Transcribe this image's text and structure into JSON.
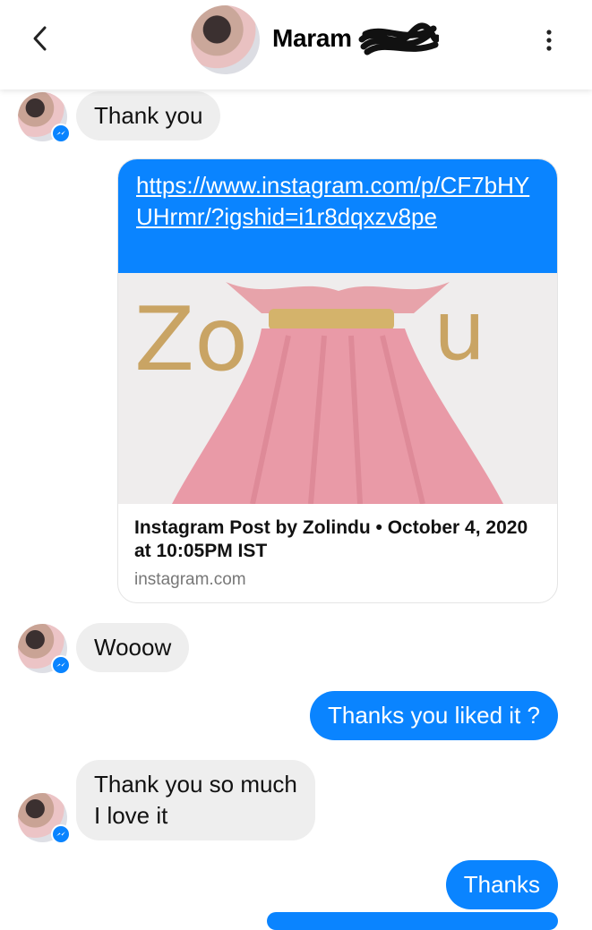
{
  "header": {
    "contact_name": "Maram"
  },
  "messages": {
    "m1": "Thank you",
    "link_url": "https://www.instagram.com/p/CF7bHYUHrmr/?igshid=i1r8dqxzv8pe",
    "link_preview_title": "Instagram Post by Zolindu • October  4, 2020 at 10:05PM IST",
    "link_preview_domain": "instagram.com",
    "m3": "Wooow",
    "m4": "Thanks you liked it ?",
    "m5_line1": "Thank you so much",
    "m5_line2": "I love it",
    "m6": "Thanks"
  },
  "colors": {
    "accent": "#0a84ff",
    "incoming_bubble": "#eeeeee"
  },
  "icons": [
    "back-chevron-icon",
    "more-vertical-icon",
    "messenger-badge-icon"
  ]
}
